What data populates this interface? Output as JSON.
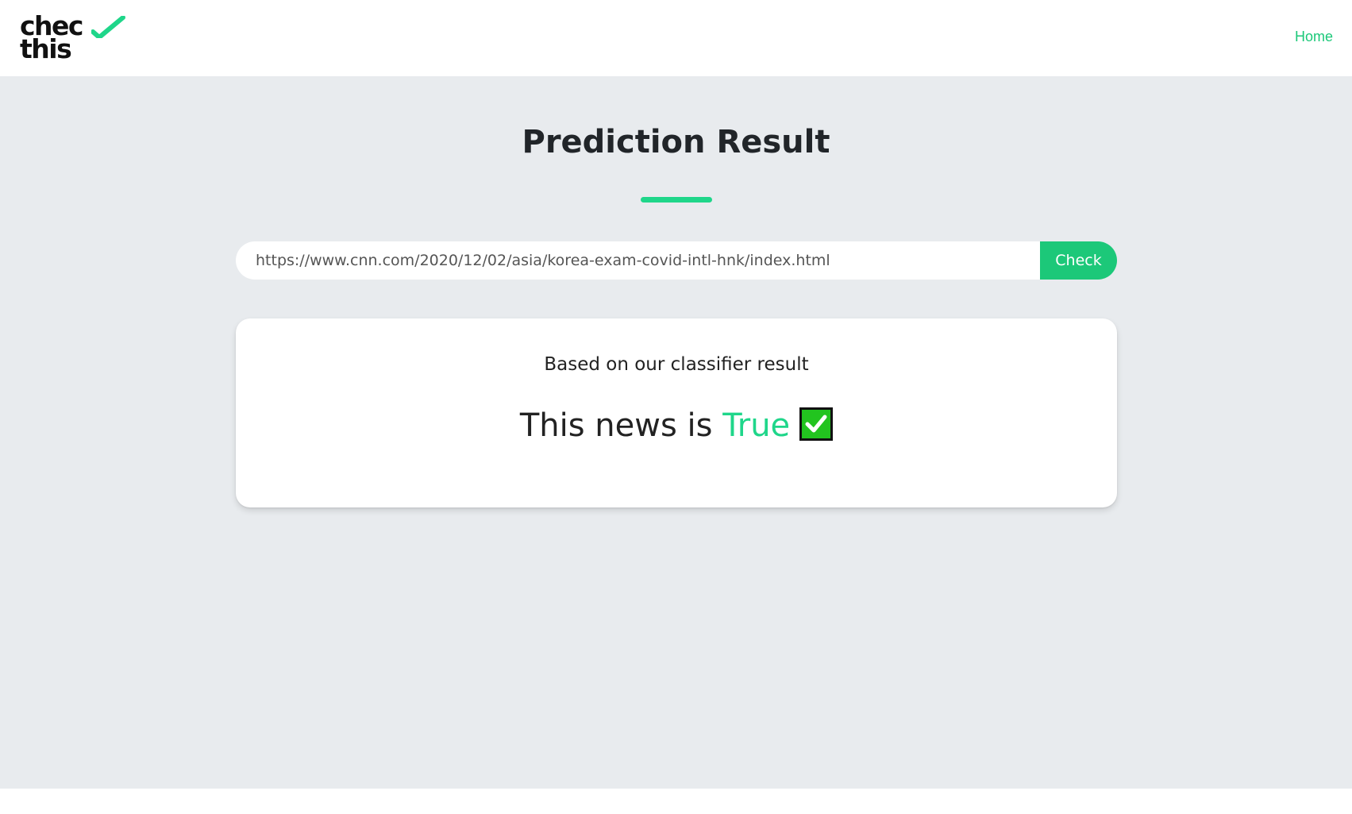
{
  "brand": {
    "line1": "chec",
    "line2": "this",
    "check_color": "#1fd68a",
    "check_icon": "checkmark-icon"
  },
  "nav": {
    "home_label": "Home"
  },
  "page": {
    "title": "Prediction Result",
    "accent_color": "#1fd68a"
  },
  "search": {
    "value": "https://www.cnn.com/2020/12/02/asia/korea-exam-covid-intl-hnk/index.html",
    "button_label": "Check",
    "button_color": "#1cc879"
  },
  "result": {
    "subtitle": "Based on our classifier result",
    "prefix": "This news is ",
    "verdict": "True",
    "verdict_color": "#1fd68a",
    "verdict_icon": "check-mark-button-icon"
  }
}
